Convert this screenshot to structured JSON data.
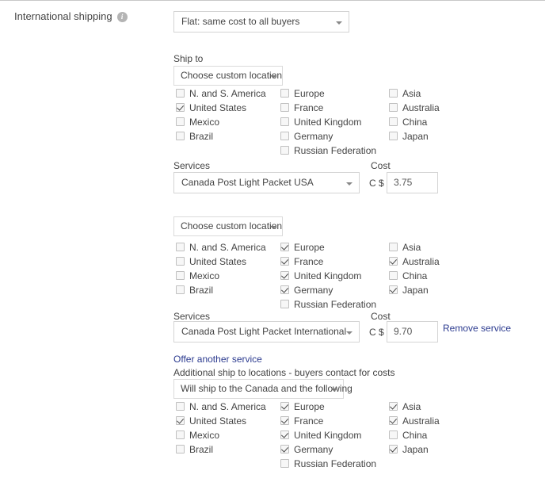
{
  "header": {
    "label": "International shipping",
    "info_icon": "info-icon",
    "shipping_type": "Flat: same cost to all buyers"
  },
  "labels": {
    "ship_to": "Ship to",
    "services": "Services",
    "cost": "Cost",
    "currency_prefix": "C $",
    "choose_location": "Choose custom location",
    "offer_another_service": "Offer another service",
    "remove_service": "Remove service",
    "additional_note": "Additional ship to locations - buyers contact for costs",
    "will_ship": "Will ship to the Canada and the following"
  },
  "columns": {
    "col1": [
      "N. and S. America",
      "United States",
      "Mexico",
      "Brazil"
    ],
    "col2": [
      "Europe",
      "France",
      "United Kingdom",
      "Germany",
      "Russian Federation"
    ],
    "col3": [
      "Asia",
      "Australia",
      "China",
      "Japan"
    ]
  },
  "blocks": [
    {
      "location_button": "Choose custom location",
      "checked": {
        "col1": [
          false,
          true,
          false,
          false
        ],
        "col2": [
          false,
          false,
          false,
          false,
          false
        ],
        "col3": [
          false,
          false,
          false,
          false
        ]
      },
      "service": "Canada Post Light Packet USA",
      "cost": "3.75"
    },
    {
      "location_button": "Choose custom location",
      "checked": {
        "col1": [
          false,
          false,
          false,
          false
        ],
        "col2": [
          true,
          true,
          true,
          true,
          false
        ],
        "col3": [
          false,
          true,
          false,
          true
        ]
      },
      "service": "Canada Post Light Packet International",
      "cost": "9.70"
    },
    {
      "location_button": "Will ship to the Canada and the following",
      "checked": {
        "col1": [
          false,
          true,
          false,
          false
        ],
        "col2": [
          true,
          true,
          true,
          true,
          false
        ],
        "col3": [
          true,
          true,
          false,
          true
        ]
      }
    }
  ],
  "colors": {
    "link": "#2b3a8f",
    "text": "#444444",
    "border": "#d4d4d4",
    "info_badge": "#b4b4b4"
  }
}
